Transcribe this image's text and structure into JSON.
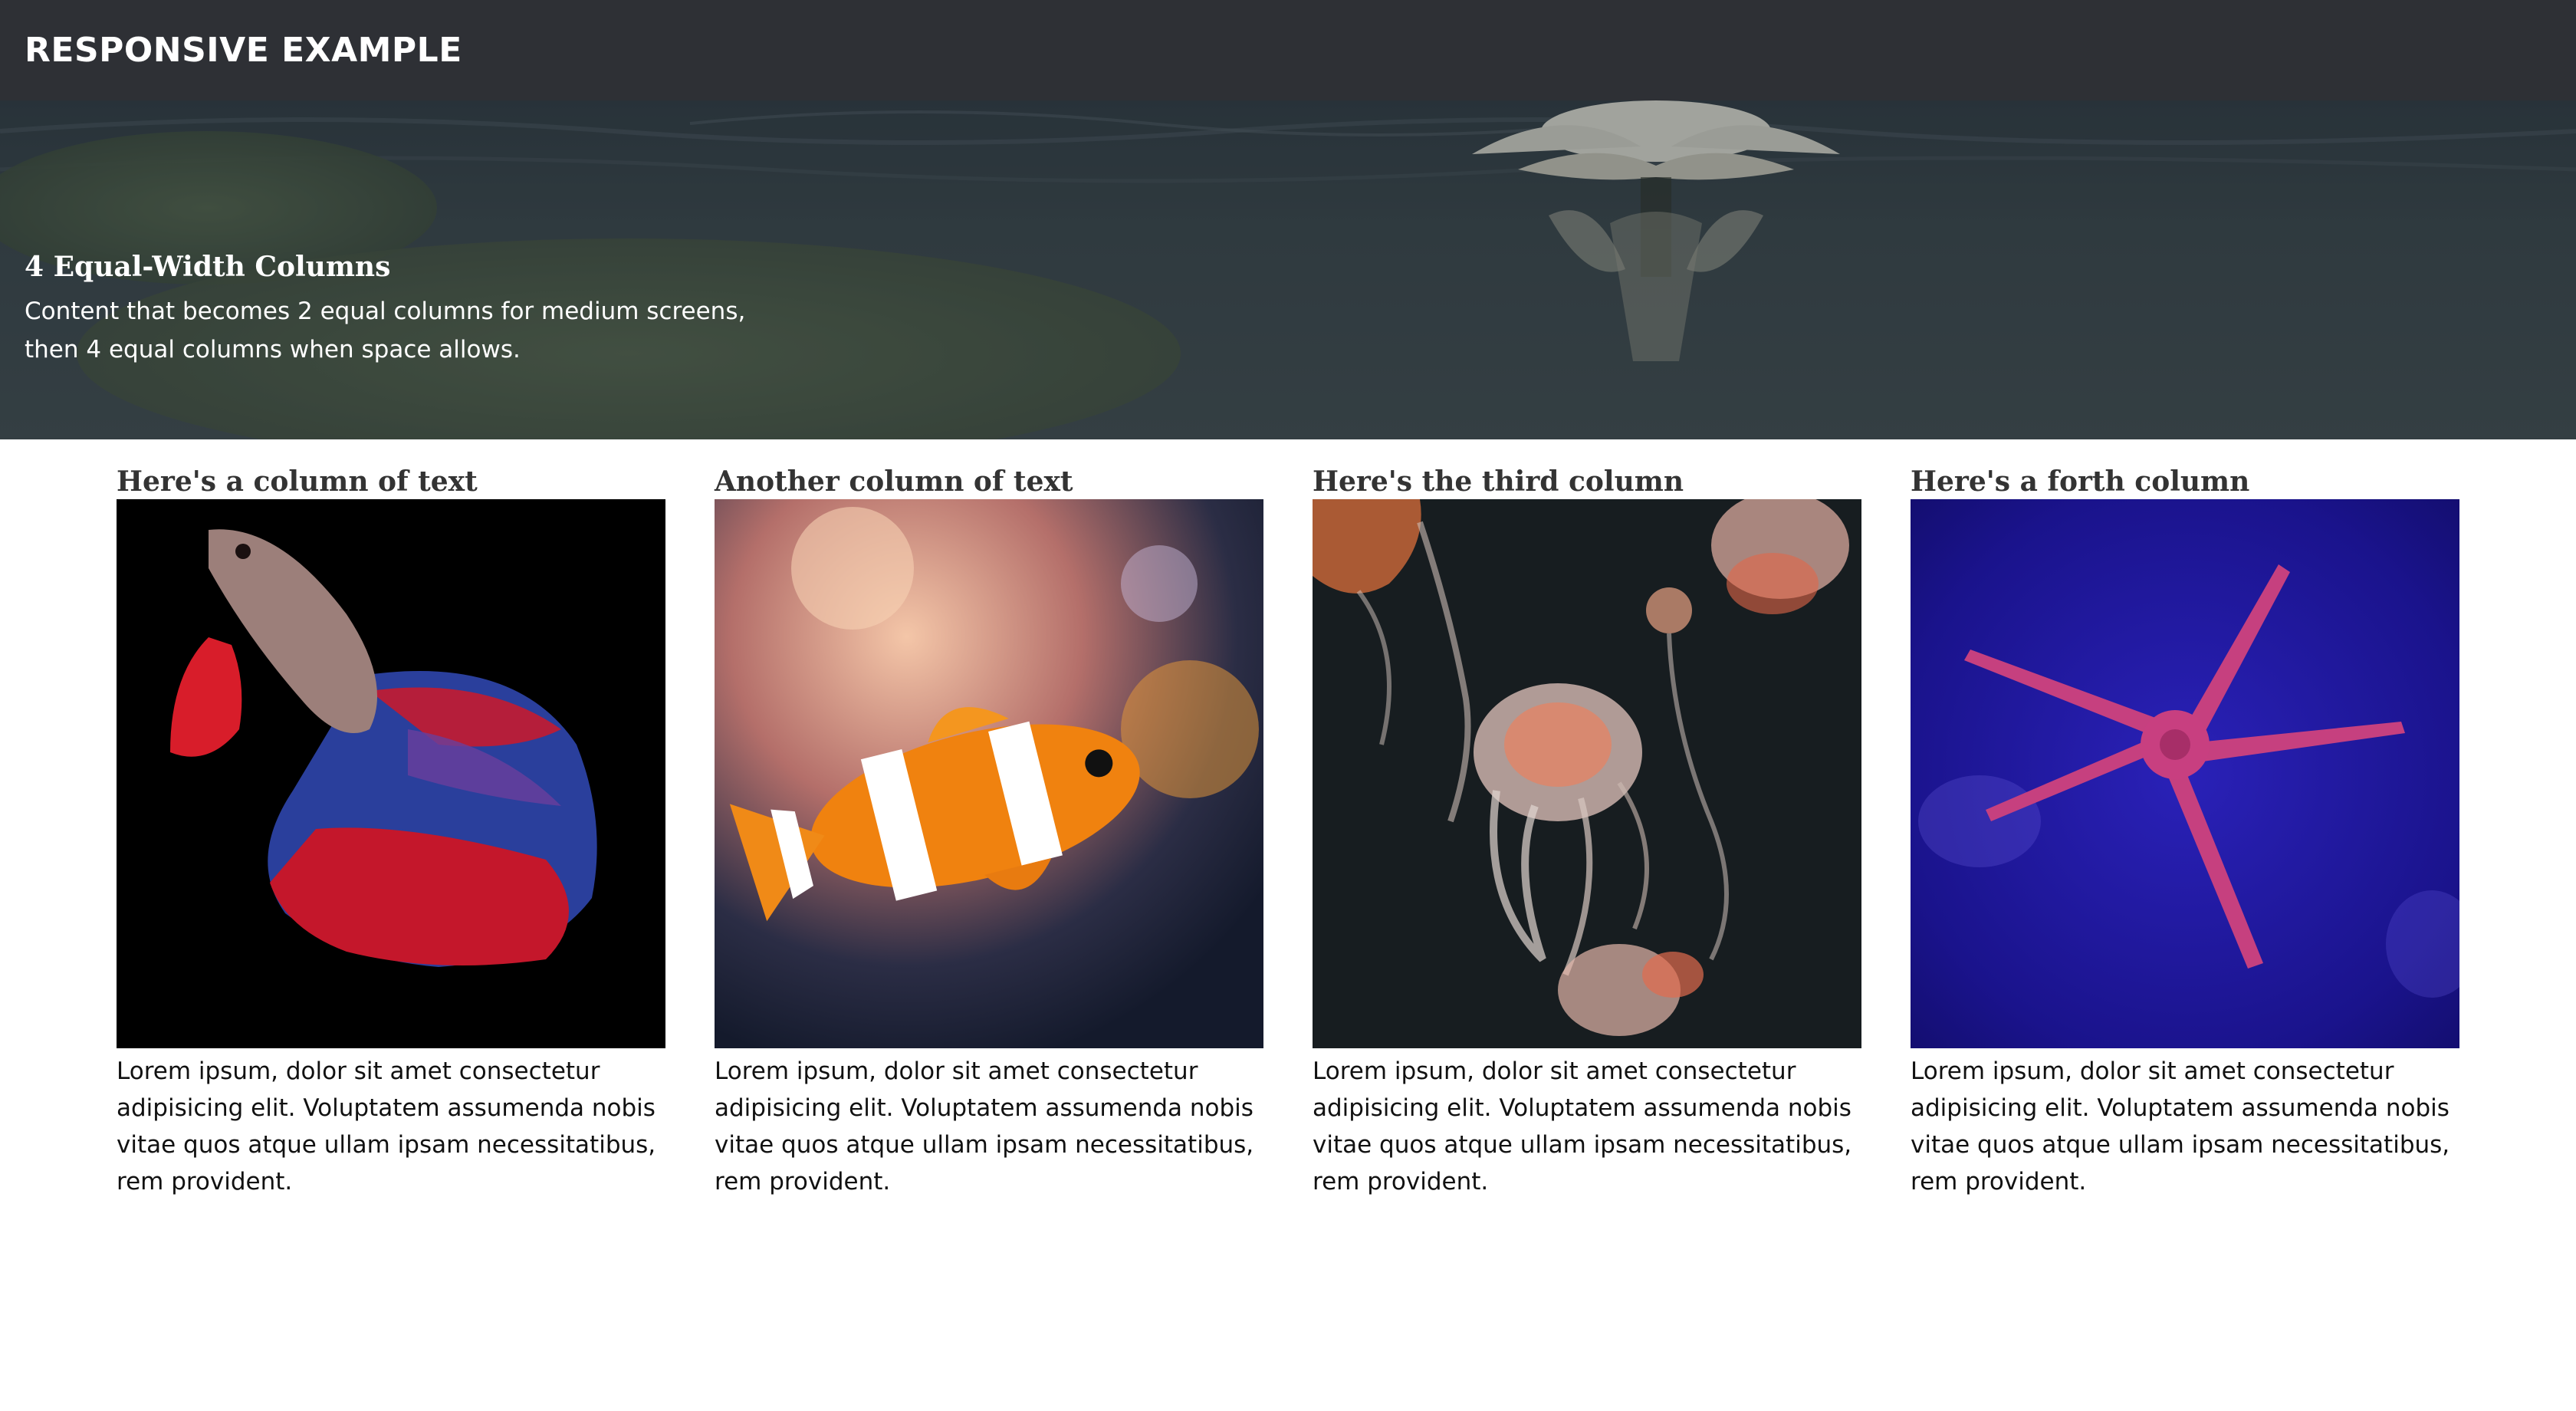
{
  "header": {
    "brand": "RESPONSIVE EXAMPLE"
  },
  "hero": {
    "title": "4 Equal-Width Columns",
    "description": "Content that becomes 2 equal columns for medium screens, then 4 equal columns when space allows."
  },
  "columns": [
    {
      "title": "Here's a column of text",
      "image": "betta-fish-photo",
      "text": "Lorem ipsum, dolor sit amet consectetur adipisicing elit. Voluptatem assumenda nobis vitae quos atque ullam ipsam necessitatibus, rem provident."
    },
    {
      "title": "Another column of text",
      "image": "clownfish-photo",
      "text": "Lorem ipsum, dolor sit amet consectetur adipisicing elit. Voluptatem assumenda nobis vitae quos atque ullam ipsam necessitatibus, rem provident."
    },
    {
      "title": "Here's the third column",
      "image": "jellyfish-photo",
      "text": "Lorem ipsum, dolor sit amet consectetur adipisicing elit. Voluptatem assumenda nobis vitae quos atque ullam ipsam necessitatibus, rem provident."
    },
    {
      "title": "Here's a forth column",
      "image": "starfish-photo",
      "text": "Lorem ipsum, dolor sit amet consectetur adipisicing elit. Voluptatem assumenda nobis vitae quos atque ullam ipsam necessitatibus, rem provident."
    }
  ],
  "colors": {
    "header_bg": "#2e3035",
    "header_text": "#ffffff",
    "hero_text": "#ffffff",
    "column_title": "#333333",
    "body_text": "#111111"
  }
}
